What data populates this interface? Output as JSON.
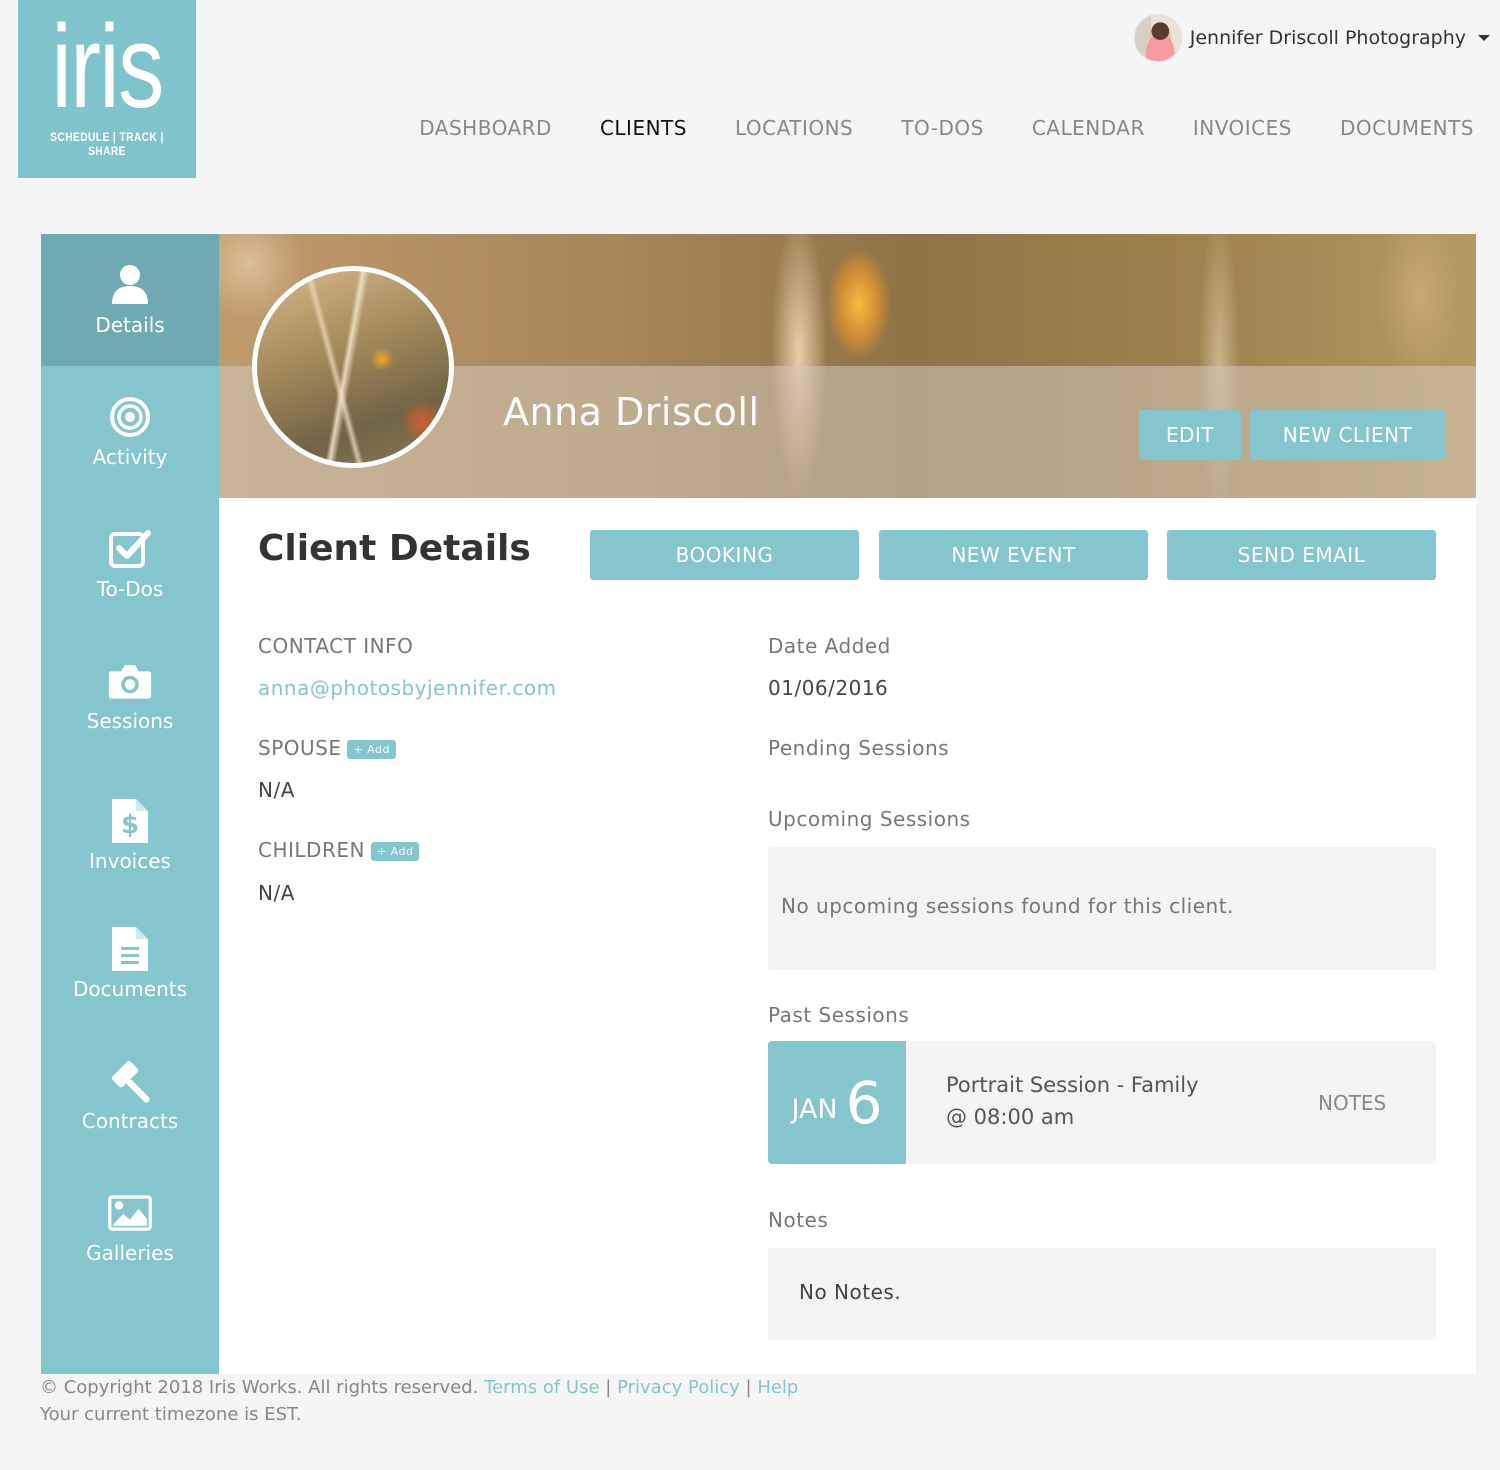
{
  "logo": {
    "word": "iris",
    "tagline": "SCHEDULE | TRACK | SHARE"
  },
  "user": {
    "name": "Jennifer Driscoll Photography"
  },
  "nav": {
    "items": [
      {
        "label": "DASHBOARD",
        "active": false
      },
      {
        "label": "CLIENTS",
        "active": true
      },
      {
        "label": "LOCATIONS",
        "active": false
      },
      {
        "label": "TO-DOS",
        "active": false
      },
      {
        "label": "CALENDAR",
        "active": false
      },
      {
        "label": "INVOICES",
        "active": false
      },
      {
        "label": "DOCUMENTS",
        "active": false
      }
    ]
  },
  "sidebar": {
    "items": [
      {
        "label": "Details",
        "icon": "user-icon",
        "active": true
      },
      {
        "label": "Activity",
        "icon": "target-icon"
      },
      {
        "label": "To-Dos",
        "icon": "checkbox-icon"
      },
      {
        "label": "Sessions",
        "icon": "camera-icon"
      },
      {
        "label": "Invoices",
        "icon": "invoice-dollar-icon"
      },
      {
        "label": "Documents",
        "icon": "document-icon"
      },
      {
        "label": "Contracts",
        "icon": "gavel-icon"
      },
      {
        "label": "Galleries",
        "icon": "image-icon"
      }
    ]
  },
  "banner": {
    "client_name": "Anna Driscoll",
    "edit_label": "EDIT",
    "new_client_label": "NEW CLIENT"
  },
  "details": {
    "title": "Client Details",
    "actions": {
      "booking": "BOOKING",
      "new_event": "NEW EVENT",
      "send_email": "SEND EMAIL"
    },
    "contact_label": "CONTACT INFO",
    "email": "anna@photosbyjennifer.com",
    "spouse_label": "SPOUSE",
    "spouse_value": "N/A",
    "children_label": "CHILDREN",
    "children_value": "N/A",
    "add_label": "+ Add",
    "date_added_label": "Date Added",
    "date_added_value": "01/06/2016",
    "pending_label": "Pending Sessions",
    "upcoming_label": "Upcoming Sessions",
    "upcoming_empty": "No upcoming sessions found for this client.",
    "past_label": "Past Sessions",
    "past_sessions": [
      {
        "month": "JAN",
        "day": "6",
        "title": "Portrait Session - Family",
        "time": "@ 08:00 am",
        "notes_label": "NOTES"
      }
    ],
    "notes_label": "Notes",
    "notes_value": "No Notes."
  },
  "footer": {
    "copyright": "© Copyright 2018 Iris Works. All rights reserved.",
    "terms": "Terms of Use",
    "privacy": "Privacy Policy",
    "help": "Help",
    "separator": "|",
    "timezone": "Your current timezone is EST."
  },
  "colors": {
    "accent": "#84c5ce",
    "accent_active": "#6faab2",
    "background": "#f5f5f5"
  }
}
